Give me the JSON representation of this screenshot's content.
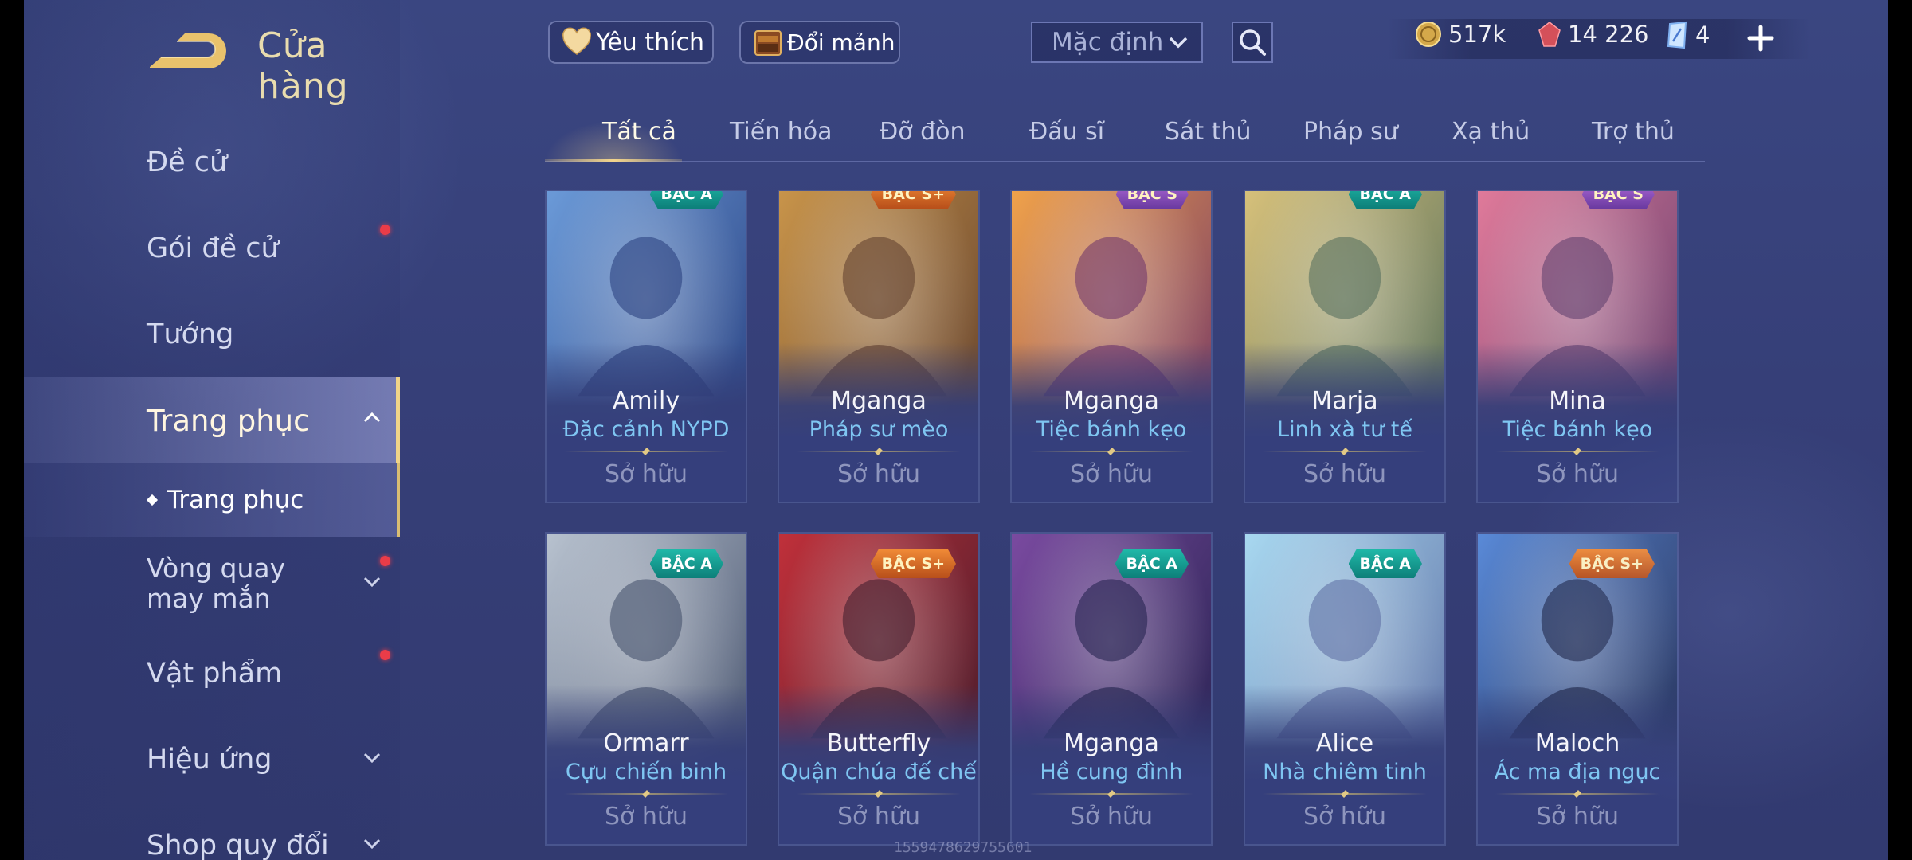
{
  "header": {
    "title": "Cửa hàng",
    "favorite_label": "Yêu thích",
    "shard_exchange_label": "Đổi mảnh",
    "sort_selected": "Mặc định"
  },
  "currency": {
    "gold": "517k",
    "vouchers": "14 226",
    "cards": "4"
  },
  "sidebar": {
    "items": [
      {
        "label": "Đề cử"
      },
      {
        "label": "Gói đề cử",
        "dot": true
      },
      {
        "label": "Tướng"
      },
      {
        "label": "Trang phục",
        "expanded": true
      },
      {
        "label": "Trang phục",
        "sub": true
      },
      {
        "label": "Vòng quay may mắn",
        "dot": true
      },
      {
        "label": "Vật phẩm",
        "dot": true
      },
      {
        "label": "Hiệu ứng"
      },
      {
        "label": "Shop quy đổi"
      }
    ]
  },
  "tabs": [
    "Tất cả",
    "Tiến hóa",
    "Đỡ đòn",
    "Đấu sĩ",
    "Sát thủ",
    "Pháp sư",
    "Xạ thủ",
    "Trợ thủ"
  ],
  "active_tab": "Tất cả",
  "cards": [
    {
      "hero": "Amily",
      "skin": "Đặc cảnh NYPD",
      "status": "Sở hữu",
      "tier": "BẬC A",
      "tier_type": "a",
      "theme": [
        "#6b9ad8",
        "#243a7a"
      ]
    },
    {
      "hero": "Mganga",
      "skin": "Pháp sư mèo",
      "status": "Sở hữu",
      "tier": "BẬC S+",
      "tier_type": "s",
      "theme": [
        "#c8944a",
        "#5b3a2a"
      ]
    },
    {
      "hero": "Mganga",
      "skin": "Tiệc bánh kẹo",
      "status": "Sở hữu",
      "tier": "BẬC S",
      "tier_type": "p",
      "theme": [
        "#f0a24a",
        "#6a2f6a"
      ]
    },
    {
      "hero": "Marja",
      "skin": "Linh xà tư tế",
      "status": "Sở hữu",
      "tier": "BẬC A",
      "tier_type": "a",
      "theme": [
        "#d6c07a",
        "#4e6a5a"
      ]
    },
    {
      "hero": "Mina",
      "skin": "Tiệc bánh kẹo",
      "status": "Sở hữu",
      "tier": "BẬC S",
      "tier_type": "p",
      "theme": [
        "#e07a9a",
        "#5a3a6a"
      ]
    },
    {
      "hero": "Ormarr",
      "skin": "Cựu chiến binh",
      "status": "Sở hữu",
      "tier": "BẬC A",
      "tier_type": "a",
      "theme": [
        "#b8c2cf",
        "#3e4a66"
      ]
    },
    {
      "hero": "Butterfly",
      "skin": "Quận chúa đế chế",
      "status": "Sở hữu",
      "tier": "BẬC S+",
      "tier_type": "s",
      "theme": [
        "#c0303a",
        "#3a1a2a"
      ]
    },
    {
      "hero": "Mganga",
      "skin": "Hề cung đình",
      "status": "Sở hữu",
      "tier": "BẬC A",
      "tier_type": "a",
      "theme": [
        "#7a4aa0",
        "#1e1e48"
      ]
    },
    {
      "hero": "Alice",
      "skin": "Nhà chiêm tinh",
      "status": "Sở hữu",
      "tier": "BẬC A",
      "tier_type": "a",
      "theme": [
        "#a8d8f0",
        "#5a6aa0"
      ]
    },
    {
      "hero": "Maloch",
      "skin": "Ác ma địa ngục",
      "status": "Sở hữu",
      "tier": "BẬC S+",
      "tier_type": "s",
      "theme": [
        "#5a8ad8",
        "#141a3a"
      ]
    }
  ],
  "watermark": "1559478629755601"
}
